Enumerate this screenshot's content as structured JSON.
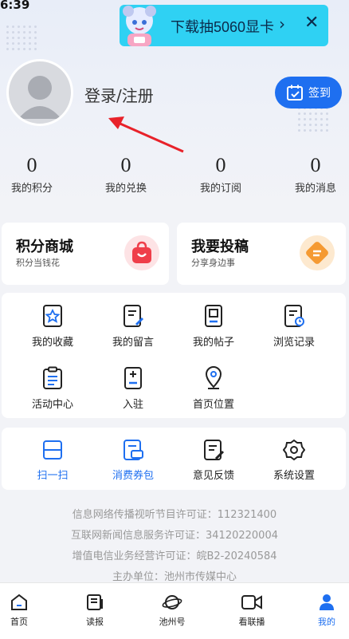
{
  "status_bar": {
    "time": "6:39"
  },
  "banner": {
    "text": "下载抽5060显卡",
    "chevron": "›",
    "close": "✕"
  },
  "profile": {
    "login_label": "登录/注册",
    "signin_label": "签到"
  },
  "stats": [
    {
      "value": "0",
      "label": "我的积分"
    },
    {
      "value": "0",
      "label": "我的兑换"
    },
    {
      "value": "0",
      "label": "我的订阅"
    },
    {
      "value": "0",
      "label": "我的消息"
    }
  ],
  "promos": [
    {
      "title": "积分商城",
      "subtitle": "积分当钱花",
      "icon": "shopping-bag-icon"
    },
    {
      "title": "我要投稿",
      "subtitle": "分享身边事",
      "icon": "submit-icon"
    }
  ],
  "menu": [
    {
      "label": "我的收藏",
      "icon": "star-icon"
    },
    {
      "label": "我的留言",
      "icon": "comment-icon"
    },
    {
      "label": "我的帖子",
      "icon": "post-icon"
    },
    {
      "label": "浏览记录",
      "icon": "history-icon"
    },
    {
      "label": "活动中心",
      "icon": "clipboard-icon"
    },
    {
      "label": "入驻",
      "icon": "register-icon"
    },
    {
      "label": "首页位置",
      "icon": "location-icon"
    }
  ],
  "tools": [
    {
      "label": "扫一扫",
      "icon": "scan-icon"
    },
    {
      "label": "消费券包",
      "icon": "coupon-icon"
    },
    {
      "label": "意见反馈",
      "icon": "feedback-icon"
    },
    {
      "label": "系统设置",
      "icon": "settings-icon"
    }
  ],
  "licenses": [
    "信息网络传播视听节目许可证：112321400",
    "互联网新闻信息服务许可证：34120220004",
    "增值电信业务经营许可证：皖B2-20240584",
    "主办单位：池州市传媒中心"
  ],
  "tabs": [
    {
      "label": "首页",
      "icon": "home-icon"
    },
    {
      "label": "读报",
      "icon": "newspaper-icon"
    },
    {
      "label": "池州号",
      "icon": "planet-icon"
    },
    {
      "label": "看联播",
      "icon": "video-icon"
    },
    {
      "label": "我的",
      "icon": "user-icon",
      "active": true
    }
  ],
  "colors": {
    "accent": "#1e6ff0",
    "banner": "#2fd1f3",
    "promo_red": "#ef3e4a",
    "promo_orange": "#f59a32"
  }
}
